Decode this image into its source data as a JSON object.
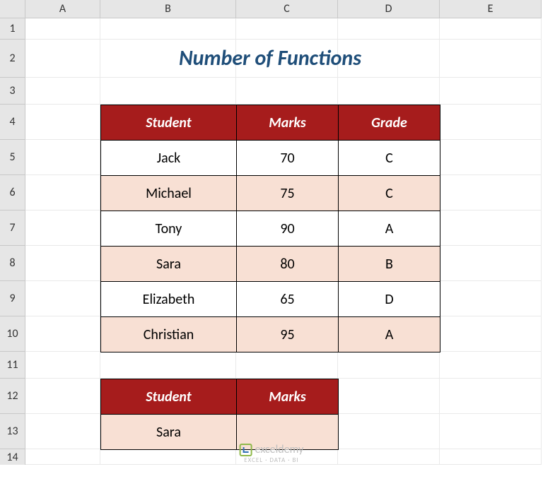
{
  "columns": [
    {
      "label": "A",
      "width": 106
    },
    {
      "label": "B",
      "width": 192
    },
    {
      "label": "C",
      "width": 144
    },
    {
      "label": "D",
      "width": 144
    },
    {
      "label": "E",
      "width": 144
    }
  ],
  "rows": [
    {
      "label": "1",
      "height": 30
    },
    {
      "label": "2",
      "height": 54
    },
    {
      "label": "3",
      "height": 38
    },
    {
      "label": "4",
      "height": 50
    },
    {
      "label": "5",
      "height": 50
    },
    {
      "label": "6",
      "height": 50
    },
    {
      "label": "7",
      "height": 50
    },
    {
      "label": "8",
      "height": 50
    },
    {
      "label": "9",
      "height": 50
    },
    {
      "label": "10",
      "height": 50
    },
    {
      "label": "11",
      "height": 38
    },
    {
      "label": "12",
      "height": 50
    },
    {
      "label": "13",
      "height": 50
    },
    {
      "label": "14",
      "height": 22
    }
  ],
  "title": "Number of Functions",
  "table1": {
    "headers": [
      "Student",
      "Marks",
      "Grade"
    ],
    "rows": [
      {
        "student": "Jack",
        "marks": "70",
        "grade": "C",
        "alt": false
      },
      {
        "student": "Michael",
        "marks": "75",
        "grade": "C",
        "alt": true
      },
      {
        "student": "Tony",
        "marks": "90",
        "grade": "A",
        "alt": false
      },
      {
        "student": "Sara",
        "marks": "80",
        "grade": "B",
        "alt": true
      },
      {
        "student": "Elizabeth",
        "marks": "65",
        "grade": "D",
        "alt": false
      },
      {
        "student": "Christian",
        "marks": "95",
        "grade": "A",
        "alt": true
      }
    ]
  },
  "table2": {
    "headers": [
      "Student",
      "Marks"
    ],
    "row": {
      "student": "Sara",
      "marks": ""
    }
  },
  "watermark": {
    "brand": "exceldemy",
    "sub": "EXCEL · DATA · BI"
  }
}
